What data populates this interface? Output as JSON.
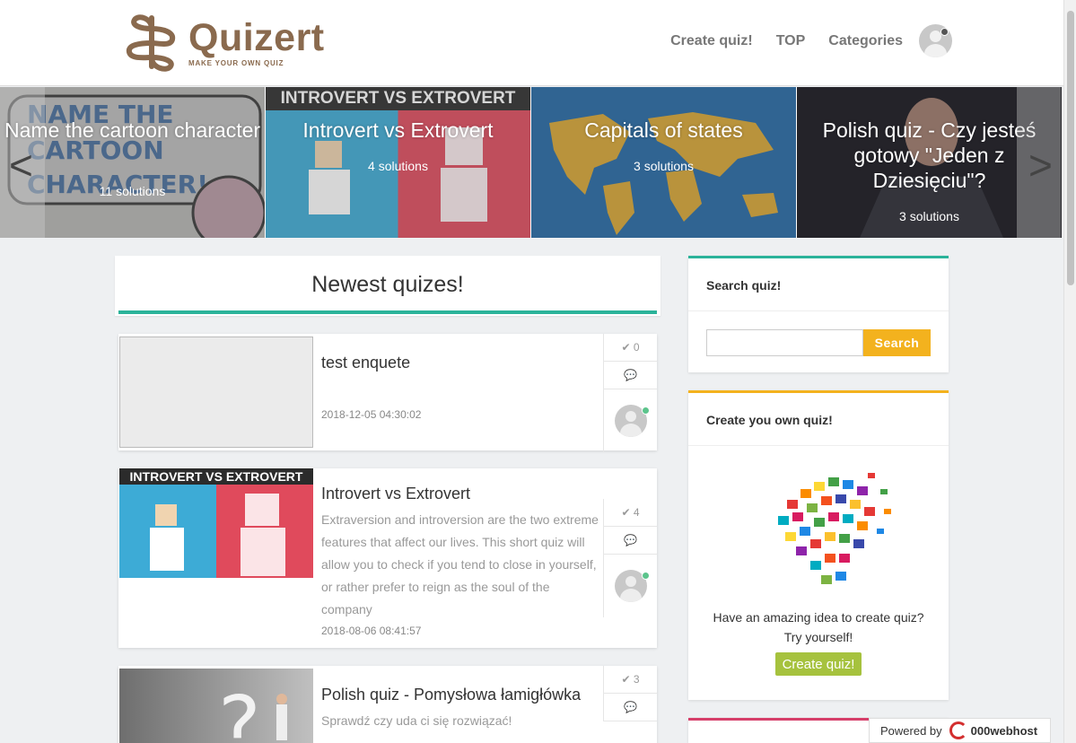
{
  "header": {
    "logo_title": "Quizert",
    "logo_tagline": "MAKE YOUR OWN QUIZ",
    "nav": [
      "Create quiz!",
      "TOP",
      "Categories"
    ]
  },
  "carousel": {
    "prev": "<",
    "next": ">",
    "slides": [
      {
        "title": "Name the cartoon character",
        "count": "11 solutions"
      },
      {
        "title": "Introvert vs Extrovert",
        "count": "4 solutions",
        "banner": "INTROVERT VS EXTROVERT"
      },
      {
        "title": "Capitals of states",
        "count": "3 solutions"
      },
      {
        "title": "Polish quiz - Czy jesteś gotowy \"Jeden z Dziesięciu\"?",
        "count": "3 solutions"
      }
    ]
  },
  "main": {
    "heading": "Newest quizes!",
    "quizzes": [
      {
        "title": "test enquete",
        "desc": "",
        "date": "2018-12-05 04:30:02",
        "solutions": "0"
      },
      {
        "title": "Introvert vs Extrovert",
        "desc": "Extraversion and introversion are the two extreme features that affect our lives. This short quiz will allow you to check if you tend to close in yourself, or rather prefer to reign as the soul of the company",
        "date": "2018-08-06 08:41:57",
        "solutions": "4",
        "banner": "INTROVERT VS EXTROVERT"
      },
      {
        "title": "Polish quiz - Pomysłowa łamigłówka",
        "desc": "Sprawdź czy uda ci się rozwiązać!",
        "date": "",
        "solutions": "3"
      }
    ]
  },
  "sidebar": {
    "search_title": "Search quiz!",
    "search_placeholder": "",
    "search_button": "Search",
    "create_title": "Create you own quiz!",
    "create_text": "Have an amazing idea to create quiz? Try yourself!",
    "create_button": "Create quiz!"
  },
  "footer": {
    "powered_label": "Powered by",
    "powered_brand": "000webhost"
  },
  "colors": {
    "brand": "#8a6a4e",
    "accent_green": "#2bb39a",
    "search_yellow": "#f3b21e",
    "create_green": "#a6c23e"
  }
}
